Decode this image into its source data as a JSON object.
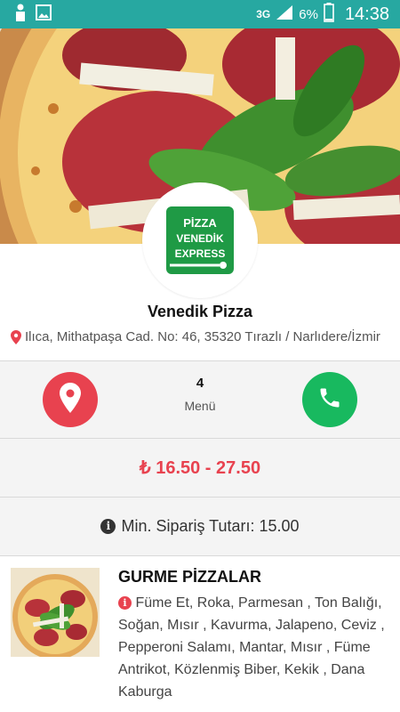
{
  "status_bar": {
    "network": "3G",
    "battery": "6%",
    "time": "14:38",
    "left_icons": [
      "notification-icon",
      "image-icon"
    ]
  },
  "restaurant": {
    "name": "Venedik Pizza",
    "address": "Ilıca, Mithatpaşa Cad. No: 46, 35320 Tırazlı / Narlıdere/İzmir",
    "logo_lines": [
      "PİZZA",
      "VENEDİK",
      "EXPRESS"
    ]
  },
  "actions": {
    "menu_count": "4",
    "menu_label": "Menü",
    "location_color": "#e8424f",
    "call_color": "#18b95f"
  },
  "price_range": "₺ 16.50 - 27.50",
  "min_order": "Min. Sipariş Tutarı: 15.00",
  "menu_items": [
    {
      "title": "GURME PİZZALAR",
      "description": "Füme Et, Roka, Parmesan , Ton Balığı, Soğan, Mısır , Kavurma, Jalapeno, Ceviz , Pepperoni Salamı, Mantar, Mısır , Füme Antrikot, Közlenmiş Biber, Kekik , Dana Kaburga"
    }
  ],
  "colors": {
    "status_bar": "#27a8a1",
    "accent_red": "#e8424f",
    "accent_green": "#18b95f"
  }
}
